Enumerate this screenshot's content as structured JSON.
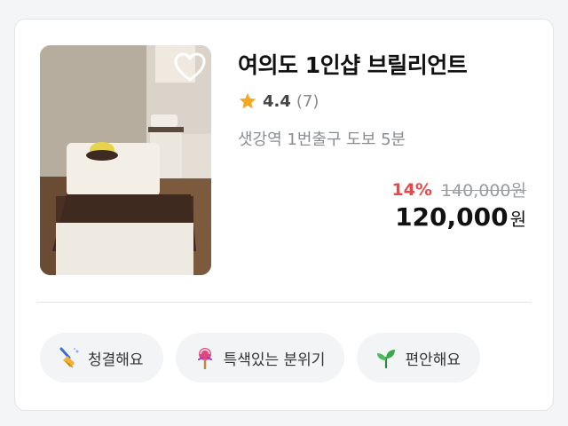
{
  "listing": {
    "title": "여의도 1인샵 브릴리언트",
    "rating": "4.4",
    "review_count": "(7)",
    "location": "샛강역 1번출구 도보 5분",
    "discount": "14%",
    "original_price": "140,000원",
    "final_price": "120,000",
    "final_price_unit": "원",
    "favorite_icon": "heart-outline-icon",
    "thumbnail_icon": "massage-room-photo"
  },
  "tags": [
    {
      "label": "청결해요",
      "icon": "broom-icon"
    },
    {
      "label": "특색있는 분위기",
      "icon": "lollipop-icon"
    },
    {
      "label": "편안해요",
      "icon": "sprout-icon"
    }
  ],
  "colors": {
    "discount": "#e8484a",
    "star": "#f5a623",
    "tag_background": "#f3f4f6"
  }
}
